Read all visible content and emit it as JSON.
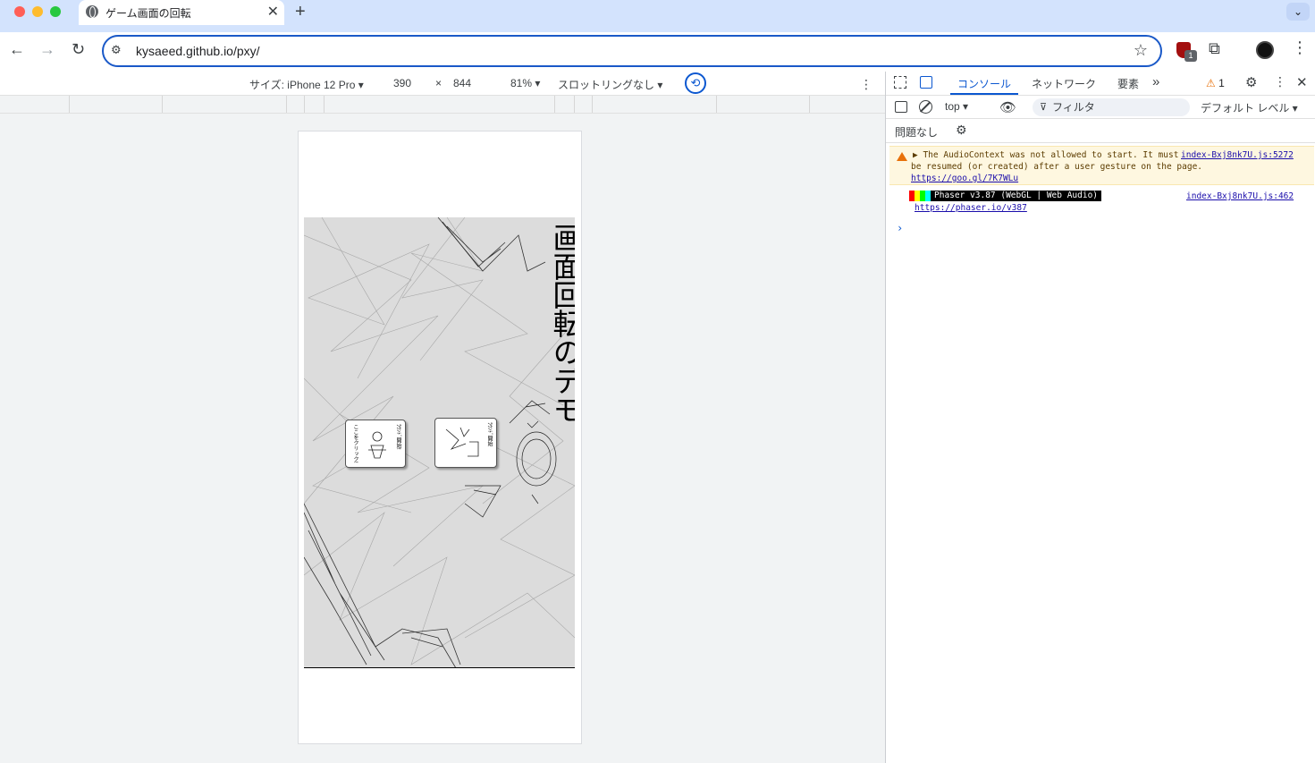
{
  "browser": {
    "tab_title": "ゲーム画面の回転",
    "tab_close": "✕",
    "new_tab": "+",
    "tab_search": "⌄",
    "url": "kysaeed.github.io/pxy/",
    "back": "←",
    "forward": "→",
    "reload": "↻",
    "site_info": "⚙",
    "star": "☆",
    "extension_badge": "1",
    "extensions": "⧉",
    "menu": "⋮"
  },
  "device_toolbar": {
    "device": "サイズ: iPhone 12 Pro ▾",
    "width": "390",
    "times": "×",
    "height": "844",
    "zoom": "81% ▾",
    "throttling": "スロットリングなし ▾",
    "rotate": "⟲",
    "more": "⋮"
  },
  "game": {
    "title": "画面回転のデモ",
    "card1_text": "ここをクリック!",
    "card1_label": "ﾗｳﾝﾄﾞ開始!",
    "card2_label": "ﾗｳﾝﾄﾞ開始"
  },
  "devtools": {
    "tabs": [
      "コンソール",
      "ネットワーク",
      "要素"
    ],
    "overflow": "»",
    "warning_count": "1",
    "warning_glyph": "⚠",
    "settings": "⚙",
    "more": "⋮",
    "close": "✕",
    "context": "top ▾",
    "eye": "👁",
    "filter_icon": "⊽",
    "filter_placeholder": "フィルタ",
    "level": "デフォルト レベル ▾",
    "issues": "問題なし",
    "issues_gear": "⚙",
    "messages": {
      "warn_line1": "▶ The AudioContext was not allowed to start. It must",
      "warn_line2": "be resumed (or created) after a user gesture on the page.",
      "warn_link": "https://goo.gl/7K7WLu",
      "warn_source": "index-Bxj8nk7U.js:5272",
      "phaser_banner": "Phaser v3.87 (WebGL | Web Audio)",
      "phaser_link": "https://phaser.io/v387",
      "phaser_source": "index-Bxj8nk7U.js:462",
      "prompt": "›"
    }
  },
  "colors": {
    "accent": "#0b57d0",
    "tabstrip": "#d3e3fd",
    "warning_bg": "#fef7e0",
    "warning": "#e8710a"
  }
}
